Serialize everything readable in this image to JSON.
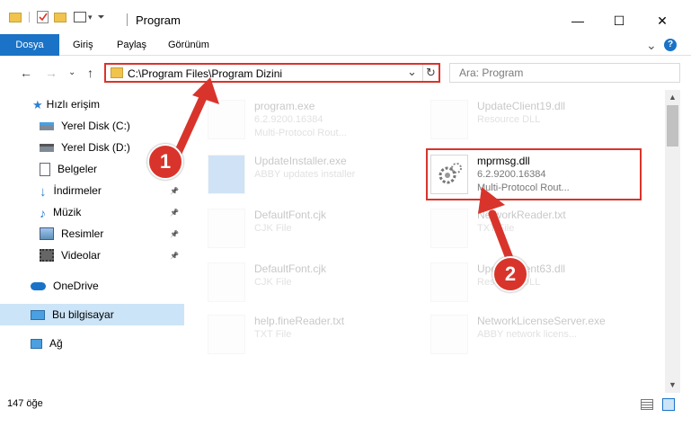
{
  "window": {
    "title": "Program",
    "minimize": "—",
    "maximize": "☐",
    "close": "✕"
  },
  "ribbon": {
    "tabs": [
      "Dosya",
      "Giriş",
      "Paylaş",
      "Görünüm"
    ],
    "expand": "⌄",
    "help": "?"
  },
  "address": {
    "back": "←",
    "forward": "→",
    "history": "⌄",
    "up": "↑",
    "path": "C:\\Program Files\\Program Dizini",
    "dropdown": "⌄",
    "refresh": "↻",
    "search_placeholder": "Ara: Program"
  },
  "sidebar": {
    "items": [
      {
        "label": "Hızlı erişim",
        "icon": "star-icon",
        "pinned": false
      },
      {
        "label": "Yerel Disk (C:)",
        "icon": "disk-icon",
        "pinned": false
      },
      {
        "label": "Yerel Disk (D:)",
        "icon": "disk-icon",
        "pinned": false
      },
      {
        "label": "Belgeler",
        "icon": "document-icon",
        "pinned": false
      },
      {
        "label": "İndirmeler",
        "icon": "download-icon",
        "pinned": true
      },
      {
        "label": "Müzik",
        "icon": "music-icon",
        "pinned": true
      },
      {
        "label": "Resimler",
        "icon": "pictures-icon",
        "pinned": true
      },
      {
        "label": "Videolar",
        "icon": "video-icon",
        "pinned": true
      },
      {
        "label": "OneDrive",
        "icon": "cloud-icon",
        "pinned": false
      },
      {
        "label": "Bu bilgisayar",
        "icon": "computer-icon",
        "pinned": false
      },
      {
        "label": "Ağ",
        "icon": "network-icon",
        "pinned": false
      }
    ],
    "pin_glyph": "📌"
  },
  "files": [
    {
      "name": "program.exe",
      "line2": "6.2.9200.16384",
      "line3": "Multi-Protocol Rout...",
      "icon": "exe-icon",
      "faded": true
    },
    {
      "name": "UpdateClient19.dll",
      "line2": "Resource DLL",
      "line3": "",
      "icon": "gear-file-icon",
      "faded": true
    },
    {
      "name": "UpdateInstaller.exe",
      "line2": "ABBY updates installer",
      "line3": "",
      "icon": "installer-icon",
      "faded": true
    },
    {
      "name": "mprmsg.dll",
      "line2": "6.2.9200.16384",
      "line3": "Multi-Protocol Rout...",
      "icon": "gear-file-icon",
      "faded": false
    },
    {
      "name": "DefaultFont.cjk",
      "line2": "CJK File",
      "line3": "",
      "icon": "blank-file-icon",
      "faded": true
    },
    {
      "name": "NetworkReader.txt",
      "line2": "TXT File",
      "line3": "",
      "icon": "blank-file-icon",
      "faded": true
    },
    {
      "name": "DefaultFont.cjk",
      "line2": "CJK File",
      "line3": "",
      "icon": "blank-file-icon",
      "faded": true
    },
    {
      "name": "UpdateClient63.dll",
      "line2": "Resource DLL",
      "line3": "",
      "icon": "gear-file-icon",
      "faded": true
    },
    {
      "name": "help.fineReader.txt",
      "line2": "TXT File",
      "line3": "",
      "icon": "blank-file-icon",
      "faded": true
    },
    {
      "name": "NetworkLicenseServer.exe",
      "line2": "ABBY network licens...",
      "line3": "",
      "icon": "exe-icon",
      "faded": true
    }
  ],
  "callouts": [
    "1",
    "2"
  ],
  "status": {
    "count": "147 öğe"
  },
  "colors": {
    "accent": "#1a73c6",
    "highlight": "#d9342b",
    "selected": "#cce4f7"
  }
}
